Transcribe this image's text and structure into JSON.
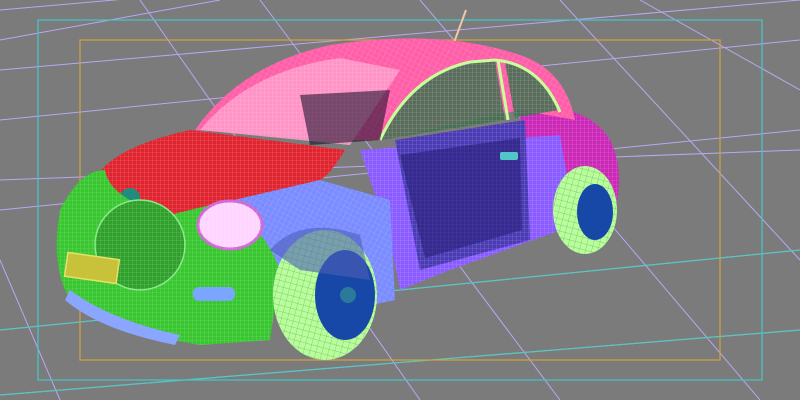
{
  "viewport": {
    "view": "perspective",
    "background": "#7b7b7b",
    "grid_color": "#b9a7f2",
    "grid_axis_color": "#55c7c0",
    "safe_frame_outer_color": "#41c8c8",
    "safe_frame_inner_color": "#d1a33a"
  },
  "model": {
    "display_mode": "wireframe",
    "part_colors": {
      "hood": "#e0242f",
      "front_fender": "#38c72f",
      "roof": "#ff5fa8",
      "door": "#4a3bb4",
      "side_panel": "#8a5cff",
      "rear_fender": "#cc28b7",
      "tire": "#b8ff9c",
      "rim": "#1748a8",
      "headlight": "#ffd5ff",
      "glass": "#ff9ccb",
      "interior": "#0c0a22"
    }
  }
}
